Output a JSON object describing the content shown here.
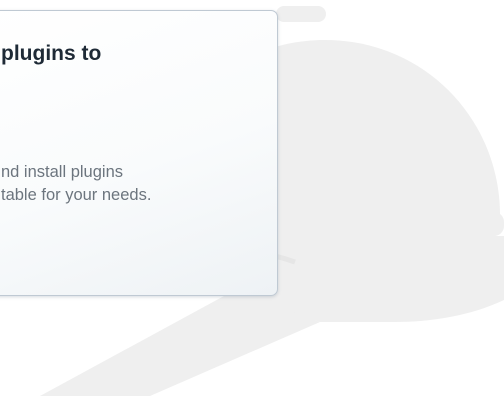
{
  "card": {
    "title": "plugins to",
    "description_lines": [
      "nd install plugins",
      "table for your needs."
    ]
  },
  "illustration": {
    "icon": "serving-cloche-hand-icon",
    "color": "#efefef"
  },
  "colors": {
    "card_border": "#bfc9d3",
    "title_text": "#1e2a36",
    "description_text": "#6c757e"
  }
}
